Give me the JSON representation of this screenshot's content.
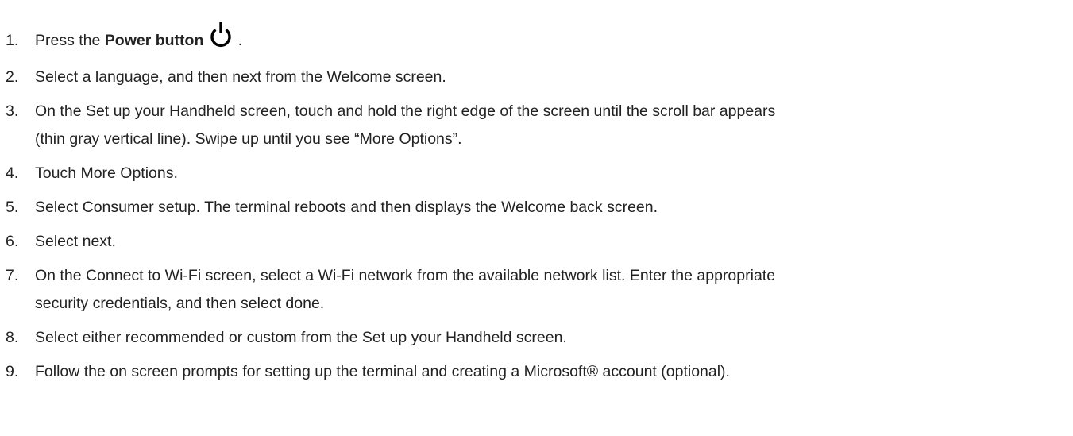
{
  "steps": [
    {
      "num": "1.",
      "pre": "Press the ",
      "bold": "Power button",
      "post": " ."
    },
    {
      "num": "2.",
      "text": "Select a language, and then next from the Welcome screen."
    },
    {
      "num": "3.",
      "text": "On the Set up your Handheld screen, touch and hold the right edge of the screen until the scroll bar appears",
      "cont": "(thin gray vertical line). Swipe up until you see “More Options”."
    },
    {
      "num": "4.",
      "text": "Touch More Options."
    },
    {
      "num": "5.",
      "text": "Select Consumer setup. The terminal reboots and then displays the Welcome back screen."
    },
    {
      "num": "6.",
      "text": "Select next."
    },
    {
      "num": "7.",
      "text": "On the Connect to Wi-Fi screen, select a Wi-Fi network from the available network list. Enter the appropriate",
      "cont": "security credentials, and then select done."
    },
    {
      "num": "8.",
      "text": "Select either recommended or custom from the Set up your Handheld screen."
    },
    {
      "num": "9.",
      "text": "Follow the on screen prompts for setting up the terminal and creating a Microsoft® account (optional)."
    }
  ],
  "icons": {
    "power": "power-icon"
  }
}
